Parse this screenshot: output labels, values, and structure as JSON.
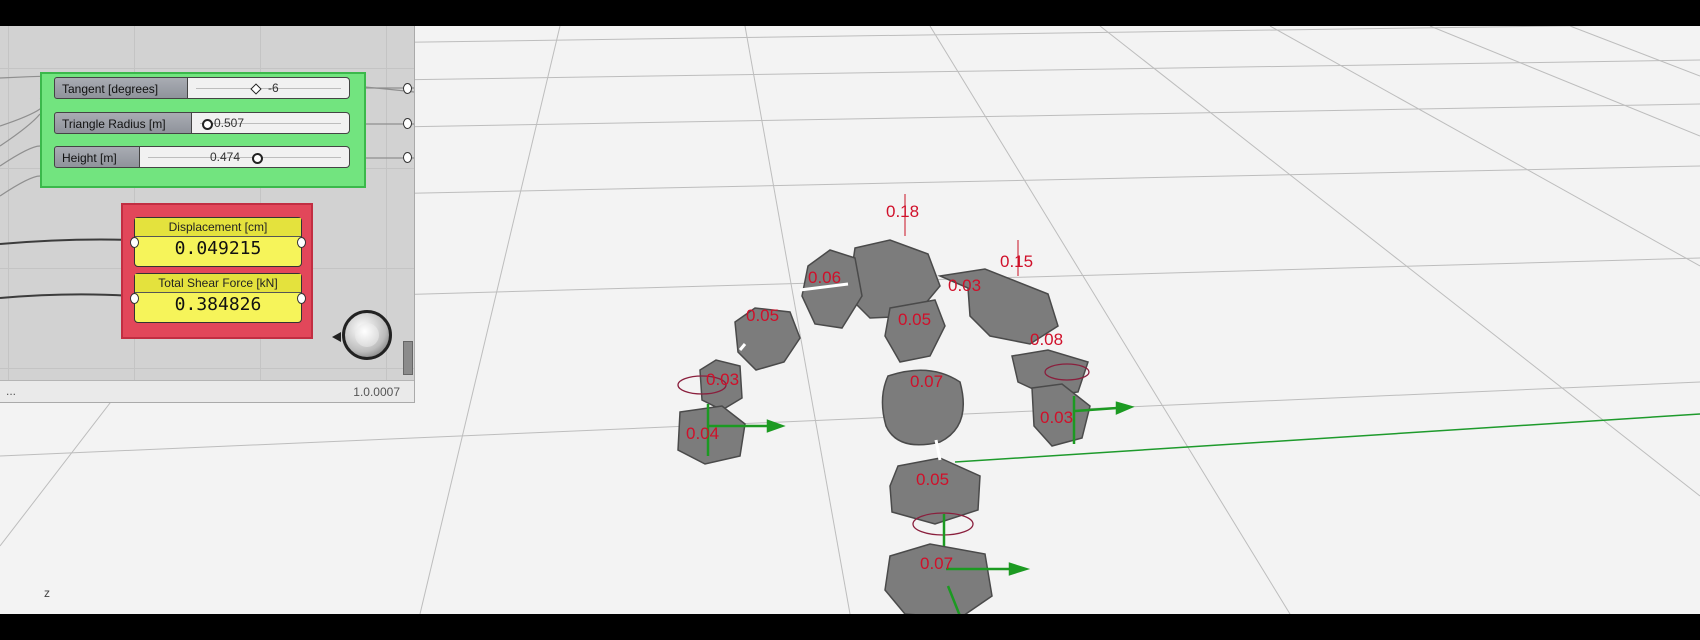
{
  "grasshopper": {
    "sliders": [
      {
        "label": "Tangent [degrees]",
        "value": "-6"
      },
      {
        "label": "Triangle Radius [m]",
        "value": "0.507"
      },
      {
        "label": "Height [m]",
        "value": "0.474"
      }
    ],
    "panels": [
      {
        "title": "Displacement [cm]",
        "value": "0.049215"
      },
      {
        "title": "Total Shear Force [kN]",
        "value": "0.384826"
      }
    ],
    "status_left": "...",
    "status_version": "1.0.0007",
    "group_colors": {
      "input": "#6fe07f",
      "output": "#e0475a"
    }
  },
  "viewport": {
    "axis_label": "z",
    "stone_labels": [
      "0.18",
      "0.15",
      "0.06",
      "0.03",
      "0.05",
      "0.05",
      "0.08",
      "0.03",
      "0.07",
      "0.03",
      "0.04",
      "0.05",
      "0.07"
    ],
    "label_color": "#d0102a"
  }
}
